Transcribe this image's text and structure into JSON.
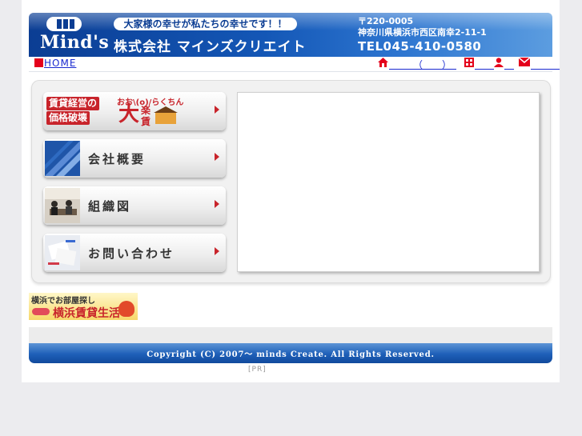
{
  "header": {
    "logo_text": "Mind's",
    "slogan": "大家様の幸せが私たちの幸せです！！",
    "company_name": "株式会社 マインズクリエイト",
    "postal_code": "〒220-0005",
    "address": "神奈川県横浜市西区南幸2-11-1",
    "phone": "TEL045-410-0580"
  },
  "nav": {
    "home_label": "HOME",
    "home_square_color": "#e4001b",
    "right_links": [
      {
        "icon": "house-icon",
        "label": "　　　（　　）　"
      },
      {
        "icon": "building-icon",
        "label": "　　"
      },
      {
        "icon": "person-icon",
        "label": "　"
      },
      {
        "icon": "mail-icon",
        "label": "　　　"
      }
    ]
  },
  "menu": {
    "promo": {
      "line1": "賃貸経営の",
      "line2": "価格破壊",
      "brand_small": "おお\\(o)/らくちん",
      "brand_big": "大",
      "brand_chars": "楽賃"
    },
    "items": [
      {
        "label": "会社概要",
        "thumb": "blue-building-thumb"
      },
      {
        "label": "組織図",
        "thumb": "meeting-photo-thumb"
      },
      {
        "label": "お問い合わせ",
        "thumb": "documents-photo-thumb"
      }
    ]
  },
  "side_banner": {
    "line1": "横浜でお部屋探し",
    "line2": "横浜賃貸生活"
  },
  "footer": {
    "copyright": "Copyright (C) 2007～ minds Create. All Rights Reserved.",
    "pr": "[PR]"
  },
  "colors": {
    "brand_blue": "#0b3d93",
    "accent_red": "#c8242b",
    "link_blue": "#1a2ad0"
  }
}
